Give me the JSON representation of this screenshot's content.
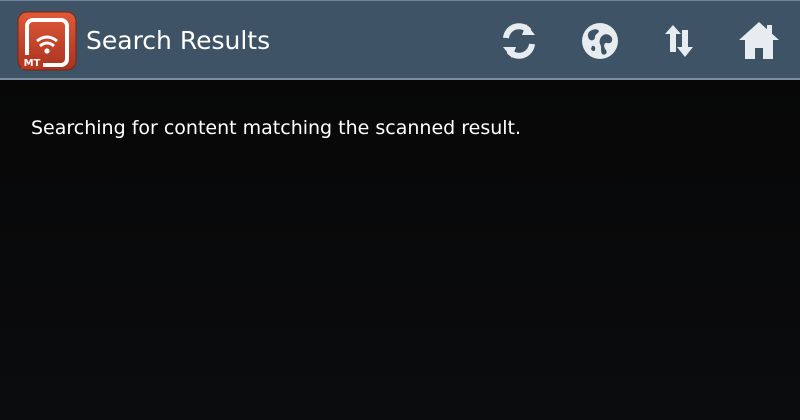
{
  "actionbar": {
    "app_icon": {
      "name": "mobile-tag-app-icon",
      "badge_text": "MT"
    },
    "title": "Search Results",
    "actions": [
      {
        "name": "refresh-icon"
      },
      {
        "name": "globe-icon"
      },
      {
        "name": "sort-icon"
      },
      {
        "name": "home-icon"
      }
    ]
  },
  "content": {
    "status_text": "Searching for content matching the scanned result."
  },
  "colors": {
    "actionbar_bg": "#3e5466",
    "icon_color": "#e6ecf0",
    "app_icon_bg": "#c0422a",
    "background": "#0a0b0c",
    "text": "#ffffff"
  }
}
